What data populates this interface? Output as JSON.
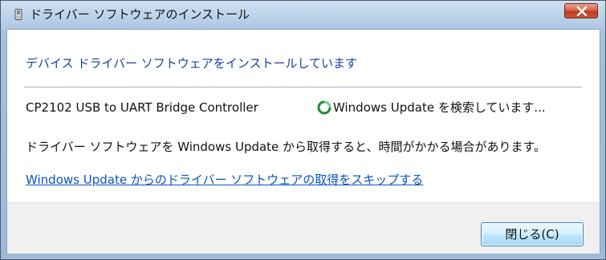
{
  "window": {
    "title": "ドライバー ソフトウェアのインストール",
    "close_icon": "close-x-icon"
  },
  "content": {
    "heading": "デバイス ドライバー ソフトウェアをインストールしています",
    "device": {
      "name": "CP2102 USB to UART Bridge Controller",
      "status_icon": "searching-spinner-icon",
      "status": "Windows Update を検索しています..."
    },
    "info_text": "ドライバー ソフトウェアを Windows Update から取得すると、時間がかかる場合があります。",
    "skip_link": "Windows Update からのドライバー ソフトウェアの取得をスキップする"
  },
  "footer": {
    "close_button": "閉じる(C)"
  },
  "colors": {
    "heading": "#1d3fa0",
    "link": "#0b53c2",
    "title_close_button": "#c2391c",
    "footer_background": "#f0f0f0"
  }
}
